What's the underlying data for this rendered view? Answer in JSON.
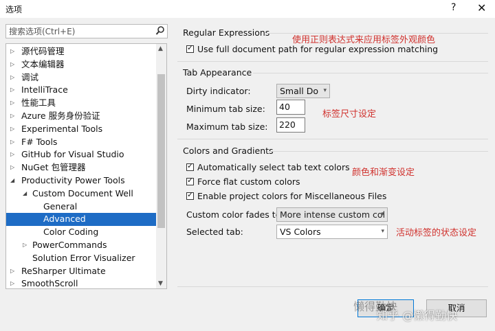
{
  "window": {
    "title": "选项",
    "help": "?",
    "close": "✕"
  },
  "search": {
    "placeholder": "搜索选项(Ctrl+E)"
  },
  "tree": [
    {
      "label": "源代码管理",
      "arrow": "▷",
      "level": 0
    },
    {
      "label": "文本编辑器",
      "arrow": "▷",
      "level": 0
    },
    {
      "label": "调试",
      "arrow": "▷",
      "level": 0
    },
    {
      "label": "IntelliTrace",
      "arrow": "▷",
      "level": 0
    },
    {
      "label": "性能工具",
      "arrow": "▷",
      "level": 0
    },
    {
      "label": "Azure 服务身份验证",
      "arrow": "▷",
      "level": 0
    },
    {
      "label": "Experimental Tools",
      "arrow": "▷",
      "level": 0
    },
    {
      "label": "F# Tools",
      "arrow": "▷",
      "level": 0
    },
    {
      "label": "GitHub for Visual Studio",
      "arrow": "▷",
      "level": 0
    },
    {
      "label": "NuGet 包管理器",
      "arrow": "▷",
      "level": 0
    },
    {
      "label": "Productivity Power Tools",
      "arrow": "◢",
      "level": 0
    },
    {
      "label": "Custom Document Well",
      "arrow": "◢",
      "level": 1
    },
    {
      "label": "General",
      "arrow": "",
      "level": 2
    },
    {
      "label": "Advanced",
      "arrow": "",
      "level": 2,
      "selected": true
    },
    {
      "label": "Color Coding",
      "arrow": "",
      "level": 2
    },
    {
      "label": "PowerCommands",
      "arrow": "▷",
      "level": 1
    },
    {
      "label": "Solution Error Visualizer",
      "arrow": "",
      "level": 1
    },
    {
      "label": "ReSharper Ultimate",
      "arrow": "▷",
      "level": 0
    },
    {
      "label": "SmoothScroll",
      "arrow": "▷",
      "level": 0
    }
  ],
  "regex": {
    "title": "Regular Expressions",
    "check_label": "Use full document path for regular expression matching",
    "note": "使用正则表达式来应用标签外观颜色"
  },
  "tab": {
    "title": "Tab Appearance",
    "dirty_label": "Dirty indicator:",
    "dirty_value": "Small Do",
    "min_label": "Minimum tab size:",
    "min_value": "40",
    "max_label": "Maximum tab size:",
    "max_value": "220",
    "note": "标签尺寸设定"
  },
  "colors": {
    "title": "Colors and Gradients",
    "auto_label": "Automatically select tab text colors",
    "flat_label": "Force flat custom colors",
    "project_label": "Enable project colors for Miscellaneous Files",
    "fades_label": "Custom color fades to:",
    "fades_value": "More intense custom col",
    "selected_label": "Selected tab:",
    "selected_value": "VS Colors",
    "note1": "颜色和渐变设定",
    "note2": "活动标签的状态设定"
  },
  "buttons": {
    "ok": "确定",
    "cancel": "取消"
  },
  "watermark": {
    "zhihu": "知乎 @懒得勤快",
    "blog": "懒得勤快"
  }
}
